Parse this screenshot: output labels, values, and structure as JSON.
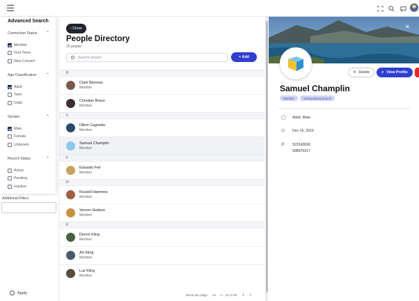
{
  "sidebar": {
    "title": "Advanced Search",
    "groups": [
      {
        "title": "Connection Status",
        "options": [
          {
            "label": "Member",
            "checked": true
          },
          {
            "label": "First Timer",
            "checked": false
          },
          {
            "label": "New Convert",
            "checked": false
          }
        ]
      },
      {
        "title": "Age Classification",
        "options": [
          {
            "label": "Adult",
            "checked": true
          },
          {
            "label": "Teen",
            "checked": false
          },
          {
            "label": "Child",
            "checked": false
          }
        ]
      },
      {
        "title": "Gender",
        "options": [
          {
            "label": "Male",
            "checked": true
          },
          {
            "label": "Female",
            "checked": false
          },
          {
            "label": "Unknown",
            "checked": false
          }
        ]
      },
      {
        "title": "Record Status",
        "options": [
          {
            "label": "Active",
            "checked": false
          },
          {
            "label": "Pending",
            "checked": false
          },
          {
            "label": "Inactive",
            "checked": false
          }
        ]
      }
    ],
    "additional_filters": "Additional Filters",
    "apply": "Apply"
  },
  "list": {
    "close": "‹ Close",
    "title": "People Directory",
    "count": "25 people",
    "search_placeholder": "Search people",
    "add": "+ Add",
    "sections": [
      {
        "letter": "B",
        "people": [
          {
            "name": "Clark Barrows",
            "role": "Member",
            "color": "#7a5a4a"
          },
          {
            "name": "Christian Braun",
            "role": "Member",
            "color": "#3a3030"
          }
        ]
      },
      {
        "letter": "C",
        "people": [
          {
            "name": "Dillon Cagnetta",
            "role": "Member",
            "color": "#2a4a6a"
          },
          {
            "name": "Samuel Champlin",
            "role": "Member",
            "color": "#8ec8e8",
            "selected": true
          }
        ]
      },
      {
        "letter": "F",
        "people": [
          {
            "name": "Eduardo Feil",
            "role": "Member",
            "color": "#c8a060"
          }
        ]
      },
      {
        "letter": "H",
        "people": [
          {
            "name": "Russell Hammes",
            "role": "Member",
            "color": "#a06040"
          },
          {
            "name": "Vernon Hudson",
            "role": "Member",
            "color": "#c89040"
          }
        ]
      },
      {
        "letter": "K",
        "people": [
          {
            "name": "Devon Kling",
            "role": "Member",
            "color": "#4a6040"
          },
          {
            "name": "Art Kling",
            "role": "Member",
            "color": "#4a5a6a"
          },
          {
            "name": "Luz Kling",
            "role": "Member",
            "color": "#5a4a40"
          }
        ]
      }
    ],
    "pager": {
      "items_label": "Items per page:",
      "per_page": "10",
      "range": "1 – 10 of 25"
    }
  },
  "detail": {
    "delete": "Delete",
    "view_profile": "View Profile",
    "name": "Samuel Champlin",
    "badges": [
      "Member",
      "Schaumberg Church"
    ],
    "info": {
      "demographics": "Adult, Male",
      "date": "Dec 16, 2019",
      "phones": [
        "522243826",
        "998975317"
      ]
    }
  },
  "colors": {
    "accent": "#2f3fcf",
    "dark": "#1f2430",
    "checked": "#1a2a5e",
    "danger": "#e0262b"
  }
}
